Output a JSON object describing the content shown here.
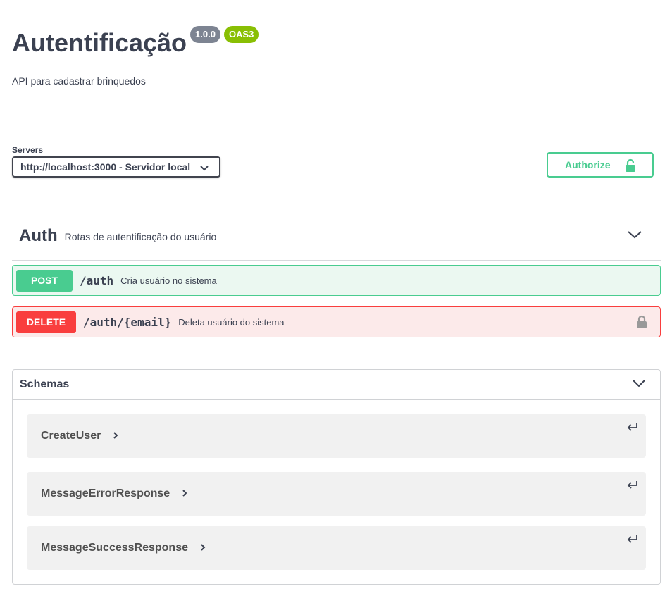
{
  "info": {
    "title": "Autentificação",
    "version_badge": "1.0.0",
    "oas_badge": "OAS3",
    "description": "API para cadastrar brinquedos"
  },
  "servers": {
    "label": "Servers",
    "selected": "http://localhost:3000 - Servidor local"
  },
  "authorize": {
    "label": "Authorize",
    "icon": "unlocked-lock-icon"
  },
  "tag": {
    "name": "Auth",
    "description": "Rotas de autentificação do usuário"
  },
  "operations": [
    {
      "method": "POST",
      "path": "/auth",
      "summary": "Cria usuário no sistema",
      "color": "#49cc90"
    },
    {
      "method": "DELETE",
      "path": "/auth/{email}",
      "summary": "Deleta usuário do sistema",
      "color": "#f93e3e",
      "icon": "lock-icon"
    }
  ],
  "schemas": {
    "title": "Schemas",
    "items": [
      {
        "name": "CreateUser"
      },
      {
        "name": "MessageErrorResponse"
      },
      {
        "name": "MessageSuccessResponse"
      }
    ]
  },
  "colors": {
    "text": "#3b4151",
    "accent_green": "#49cc90",
    "accent_red": "#f93e3e",
    "badge_gray": "#7d8492",
    "badge_green": "#89bf04"
  }
}
